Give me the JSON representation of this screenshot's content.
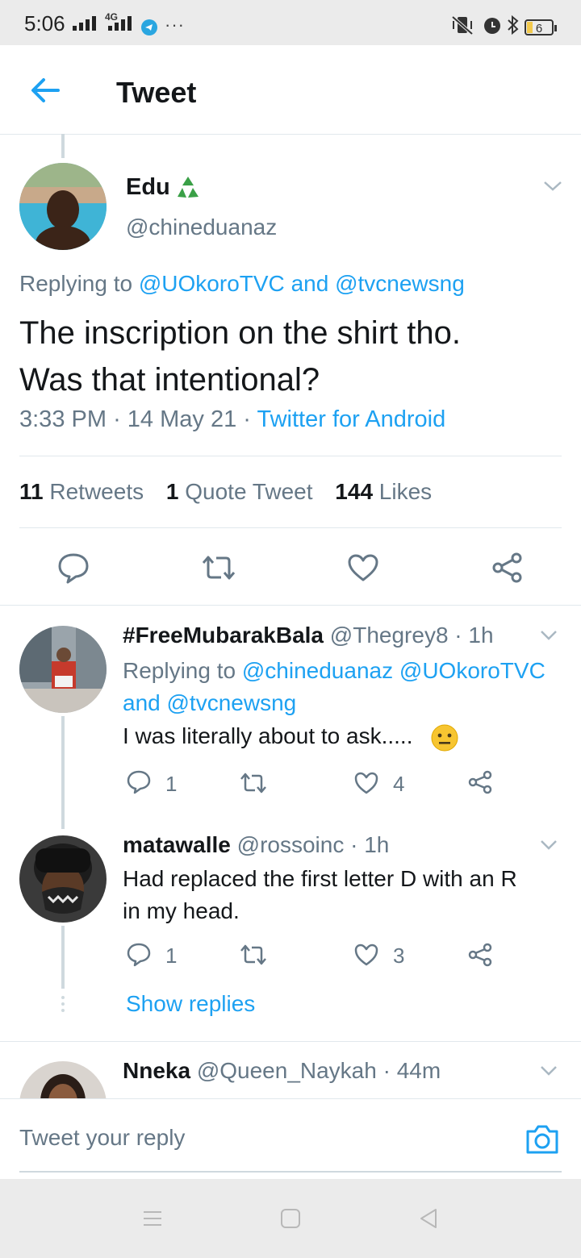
{
  "status_bar": {
    "time": "5:06",
    "network": "4G",
    "more": "···",
    "battery": "6"
  },
  "header": {
    "title": "Tweet"
  },
  "tweet": {
    "author_name": "Edu",
    "author_handle": "@chineduanaz",
    "replying_to_prefix": "Replying to",
    "replying_to_user1": "@UOkoroTVC",
    "replying_to_and": "and",
    "replying_to_user2": "@tvcnewsng",
    "text_line1": "The inscription on the shirt tho.",
    "text_line2": "Was that intentional?",
    "time": "3:33 PM",
    "sep1": "·",
    "date": "14 May 21",
    "sep2": "·",
    "source": "Twitter for Android",
    "retweets_count": "11",
    "retweets_label": "Retweets",
    "quote_count": "1",
    "quote_label": "Quote Tweet",
    "likes_count": "144",
    "likes_label": "Likes"
  },
  "replies": [
    {
      "name": "#FreeMubarakBala",
      "handle": "@Thegrey8",
      "sep": "·",
      "time": "1h",
      "replying_prefix": "Replying to",
      "replying_user1": "@chineduanaz",
      "replying_user2": "@UOkoroTVC",
      "replying_and": "and",
      "replying_user3": "@tvcnewsng",
      "text": "I was literally about to ask.....",
      "reply_count": "1",
      "like_count": "4"
    },
    {
      "name": "matawalle",
      "handle": "@rossoinc",
      "sep": "·",
      "time": "1h",
      "text_line1": "Had replaced the first letter D with an R",
      "text_line2": "in my head.",
      "reply_count": "1",
      "like_count": "3",
      "show_replies": "Show replies"
    },
    {
      "name": "Nneka",
      "handle": "@Queen_Naykah",
      "sep": "·",
      "time": "44m"
    }
  ],
  "reply_box": {
    "placeholder": "Tweet your reply"
  },
  "colors": {
    "accent": "#1da1f2",
    "secondary_text": "#657786",
    "divider": "#e1e8ed"
  }
}
